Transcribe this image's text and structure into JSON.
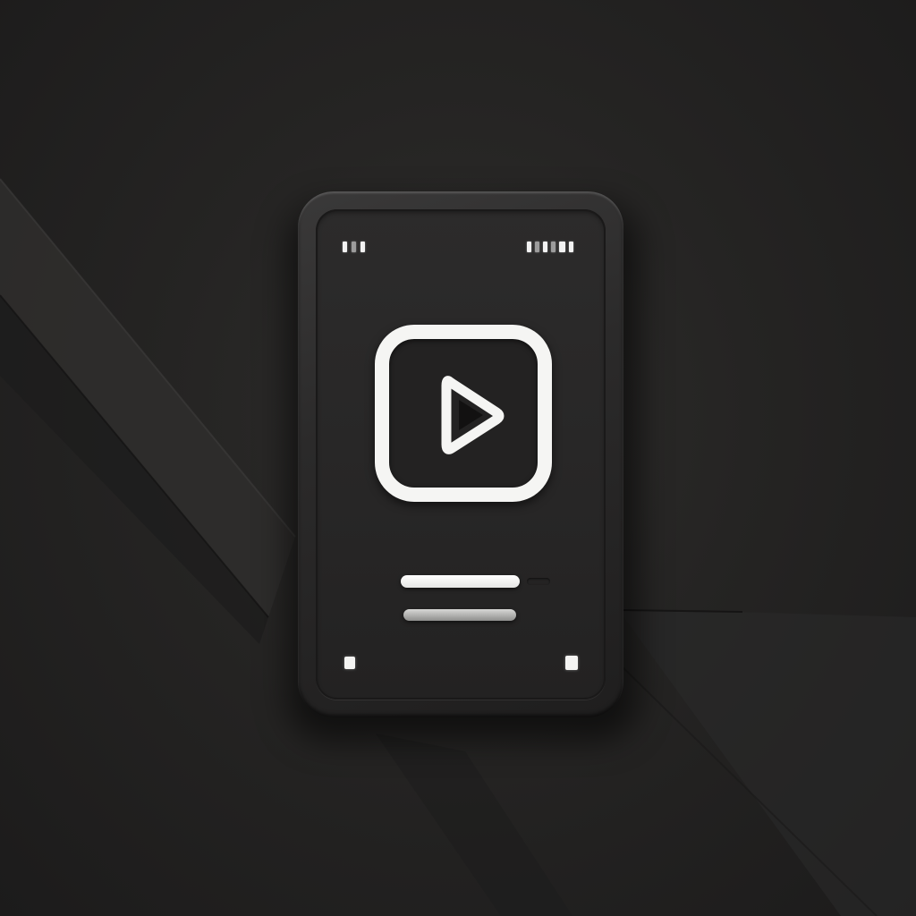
{
  "scene": {
    "background_color": "#232222",
    "icon_name": "mobile-video-app-icon"
  },
  "device": {
    "frame_color": "#2b2a2a",
    "screen_color": "#272626",
    "accent_color": "#f5f5f3"
  },
  "status_bar": {
    "left_icon": "signal-icon",
    "right_icon": "battery-icon"
  },
  "play_button": {
    "icon": "play-icon",
    "border_color": "#f5f5f3"
  },
  "text_lines": {
    "primary_icon": "title-line",
    "secondary_icon": "subtitle-line"
  }
}
